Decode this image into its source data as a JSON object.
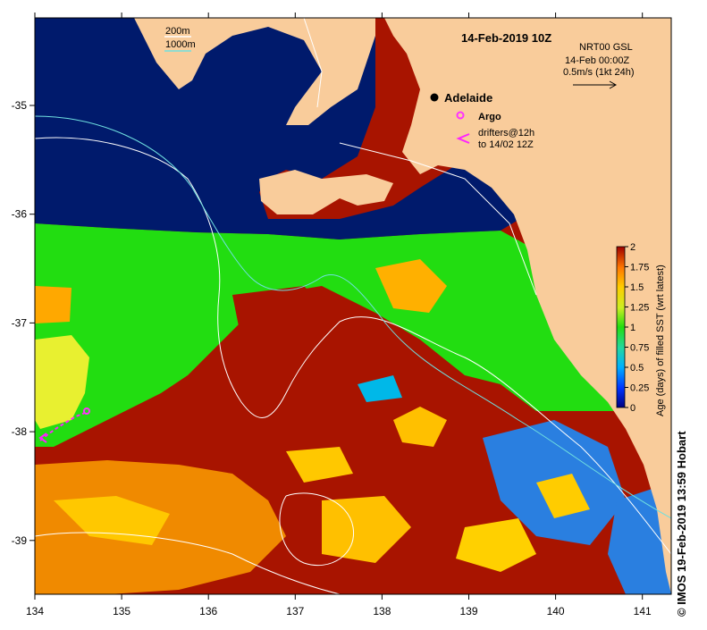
{
  "map": {
    "title": "14-Feb-2019 10Z",
    "product": "NRT00 GSL",
    "valid_time": "14-Feb 00:00Z",
    "vector_scale": "0.5m/s (1kt 24h)",
    "city": "Adelaide",
    "argo_label": "Argo",
    "drifter_label_1": "drifters@12h",
    "drifter_label_2": "to 14/02 12Z",
    "contour_200": "200m",
    "contour_1000": "1000m",
    "lon_ticks": [
      "134",
      "135",
      "136",
      "137",
      "138",
      "139",
      "140",
      "141"
    ],
    "lat_ticks": [
      "-35",
      "-36",
      "-37",
      "-38",
      "-39"
    ],
    "colors": {
      "land": "#f9cc9b",
      "deep_ocean": "#001a6c",
      "contour_200": "#ffffff",
      "contour_1000": "#6fe0e0",
      "argo": "#ff33ff",
      "drifter": "#ff22ff"
    }
  },
  "colorbar": {
    "label": "Age (days) of filled SST (wrt latest)",
    "ticks": [
      "2",
      "1.75",
      "1.5",
      "1.25",
      "1",
      "0.75",
      "0.5",
      "0.25",
      "0"
    ]
  },
  "credit": "© IMOS 19-Feb-2019 13:59 Hobart"
}
